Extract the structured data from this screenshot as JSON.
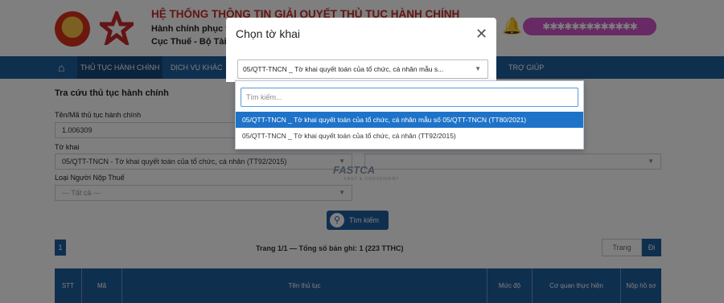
{
  "header": {
    "title": "HỆ THỐNG THÔNG TIN GIẢI QUYẾT THỦ TỤC HÀNH CHÍNH",
    "subtitle1": "Hành chính phục v",
    "subtitle2": "Cục Thuế - Bộ Tài",
    "user_badge": "✱✱✱✱✱✱✱✱✱✱✱✱✱",
    "icons": [
      "emblem-icon",
      "tax-logo-icon",
      "bell-icon"
    ]
  },
  "nav": {
    "items": [
      {
        "label": "THỦ TỤC HÀNH CHÍNH"
      },
      {
        "label": "DỊCH VỤ KHÁC"
      },
      {
        "label": "TRỢ GIÚP"
      }
    ]
  },
  "form": {
    "heading": "Tra cứu thủ tục hành chính",
    "code_label": "Tên/Mã thủ tục hành chính",
    "code_value": "1.006309",
    "declaration_label": "Tờ khai",
    "declaration_value": "05/QTT-TNCN - Tờ khai quyết toán của tổ chức, cá nhân (TT92/2015)",
    "taxpayer_label": "Loại Người Nộp Thuế",
    "taxpayer_value": "--- Tất cả ---",
    "search_button": "Tìm kiếm"
  },
  "pagination": {
    "current": "1",
    "info": "Trang 1/1 — Tổng số bản ghi: 1 (223 TTHC)",
    "page_placeholder": "Trang",
    "go_label": "Đi"
  },
  "table": {
    "columns": [
      "STT",
      "Mã",
      "Tên thủ tục",
      "Mức độ",
      "Cơ quan thực hiện",
      "Nộp hồ sơ"
    ]
  },
  "watermark": {
    "brand": "FASTCA",
    "tagline": "FAST & CONVENIENT"
  },
  "modal": {
    "title": "Chọn tờ khai",
    "selected_text": "05/QTT-TNCN _ Tờ khai quyết toán của tổ chức, cá nhân mẫu s...",
    "search_placeholder": "Tìm kiếm...",
    "options": [
      {
        "label": "05/QTT-TNCN _ Tờ khai quyết toán của tổ chức, cá nhân mẫu số 05/QTT-TNCN (TT80/2021)",
        "selected": true
      },
      {
        "label": "05/QTT-TNCN _ Tờ khai quyết toán của tổ chức, cá nhân (TT92/2015)",
        "selected": false
      }
    ]
  },
  "colors": {
    "brand_blue": "#1f5f9e",
    "selected_option": "#1e73c8",
    "title_red": "#c62a2a"
  }
}
